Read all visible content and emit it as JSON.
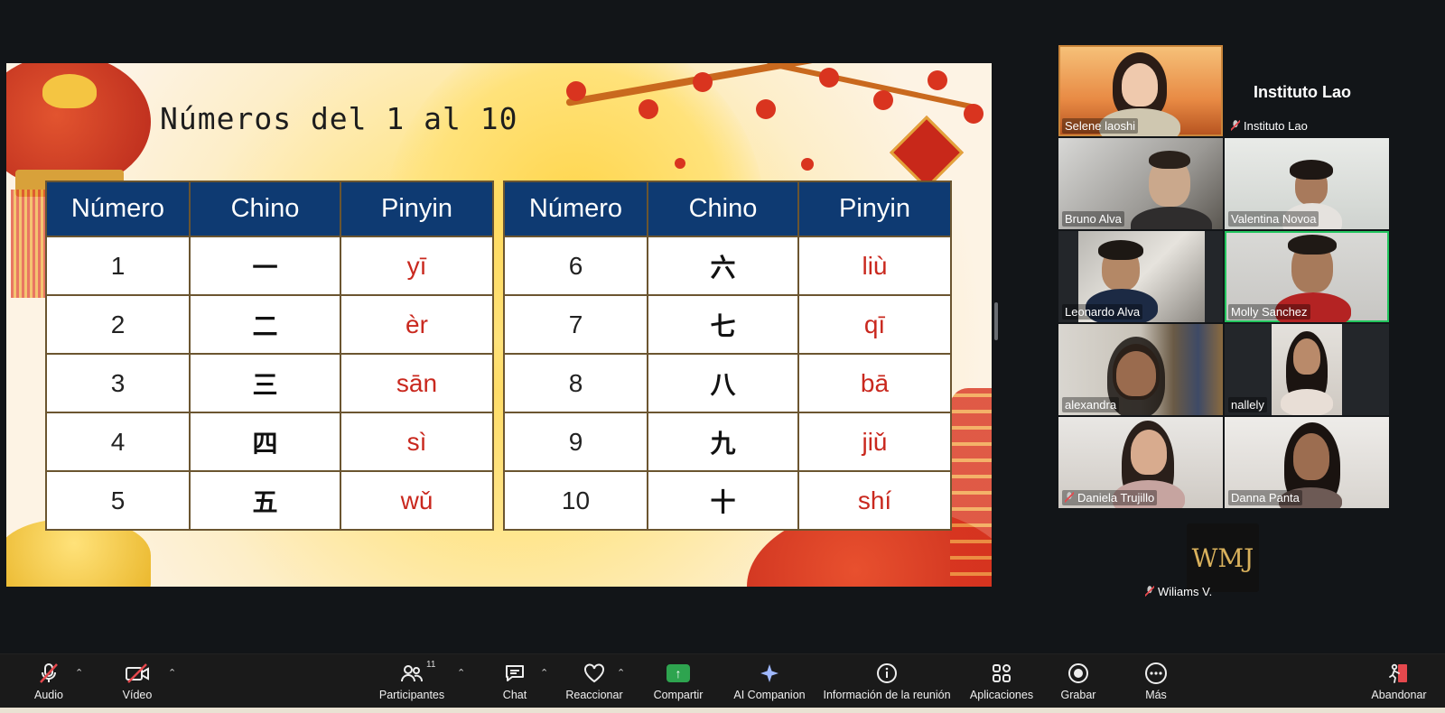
{
  "slide": {
    "title": "Números del 1 al 10",
    "headers": [
      "Número",
      "Chino",
      "Pinyin"
    ],
    "left_rows": [
      [
        "1",
        "一",
        "yī"
      ],
      [
        "2",
        "二",
        "èr"
      ],
      [
        "3",
        "三",
        "sān"
      ],
      [
        "4",
        "四",
        "sì"
      ],
      [
        "5",
        "五",
        "wǔ"
      ]
    ],
    "right_rows": [
      [
        "6",
        "六",
        "liù"
      ],
      [
        "7",
        "七",
        "qī"
      ],
      [
        "8",
        "八",
        "bā"
      ],
      [
        "9",
        "九",
        "jiǔ"
      ],
      [
        "10",
        "十",
        "shí"
      ]
    ]
  },
  "gallery": {
    "institute_title": "Instituto Lao",
    "participants": [
      {
        "name": "Selene laoshi",
        "muted": false
      },
      {
        "name": "Instituto Lao",
        "muted": true
      },
      {
        "name": "Bruno Alva",
        "muted": false
      },
      {
        "name": "Valentina Novoa",
        "muted": false
      },
      {
        "name": "Leonardo Alva",
        "muted": false
      },
      {
        "name": "Molly Sanchez",
        "muted": false,
        "speaking": true
      },
      {
        "name": "alexandra",
        "muted": false
      },
      {
        "name": "nallely",
        "muted": false
      },
      {
        "name": "Daniela Trujillo",
        "muted": true
      },
      {
        "name": "Danna Panta",
        "muted": false
      },
      {
        "name": "Wiliams V.",
        "muted": true
      }
    ],
    "wmj_logo_text": "WMJ"
  },
  "toolbar": {
    "audio": "Audio",
    "video": "Vídeo",
    "participants": "Participantes",
    "participants_count": "11",
    "chat": "Chat",
    "react": "Reaccionar",
    "share": "Compartir",
    "ai": "AI Companion",
    "info": "Información de la reunión",
    "apps": "Aplicaciones",
    "record": "Grabar",
    "more": "Más",
    "leave": "Abandonar"
  },
  "colors": {
    "header_blue": "#0e3a72",
    "pinyin_red": "#c9281e",
    "share_green": "#2ea44f",
    "active_speaker": "#22c55e"
  }
}
